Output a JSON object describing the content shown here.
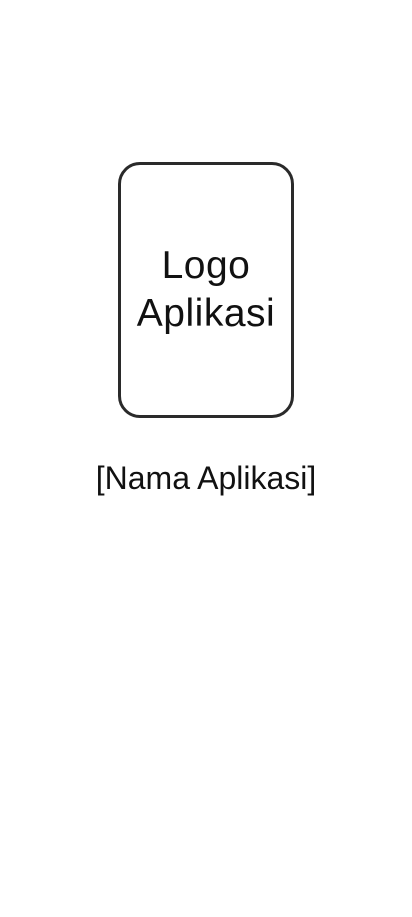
{
  "splash": {
    "logo_placeholder_line1": "Logo",
    "logo_placeholder_line2": "Aplikasi",
    "app_name": "[Nama Aplikasi]"
  },
  "colors": {
    "background": "#ffffff",
    "text": "#111111",
    "logo_border": "#2a2a2a"
  }
}
